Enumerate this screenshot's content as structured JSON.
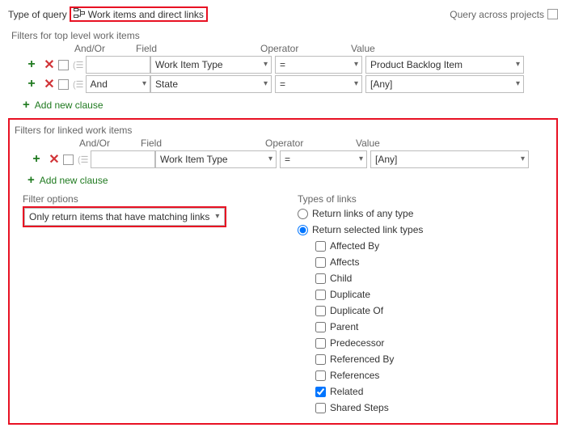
{
  "topbar": {
    "typeOfQueryLabel": "Type of query",
    "queryTypeValue": "Work items and direct links",
    "crossProjectsLabel": "Query across projects"
  },
  "topFilters": {
    "title": "Filters for top level work items",
    "headers": {
      "andOr": "And/Or",
      "field": "Field",
      "operator": "Operator",
      "value": "Value"
    },
    "rows": [
      {
        "andOr": "",
        "field": "Work Item Type",
        "operator": "=",
        "value": "Product Backlog Item"
      },
      {
        "andOr": "And",
        "field": "State",
        "operator": "=",
        "value": "[Any]"
      }
    ],
    "addClause": "Add new clause"
  },
  "linkedFilters": {
    "title": "Filters for linked work items",
    "headers": {
      "andOr": "And/Or",
      "field": "Field",
      "operator": "Operator",
      "value": "Value"
    },
    "rows": [
      {
        "andOr": "",
        "field": "Work Item Type",
        "operator": "=",
        "value": "[Any]"
      }
    ],
    "addClause": "Add new clause",
    "filterOptionsLabel": "Filter options",
    "filterOptionsValue": "Only return items that have matching links",
    "typesOfLinksLabel": "Types of links",
    "radioAny": "Return links of any type",
    "radioSelected": "Return selected link types",
    "radioChoice": "selected",
    "linkTypes": [
      {
        "label": "Affected By",
        "checked": false
      },
      {
        "label": "Affects",
        "checked": false
      },
      {
        "label": "Child",
        "checked": false
      },
      {
        "label": "Duplicate",
        "checked": false
      },
      {
        "label": "Duplicate Of",
        "checked": false
      },
      {
        "label": "Parent",
        "checked": false
      },
      {
        "label": "Predecessor",
        "checked": false
      },
      {
        "label": "Referenced By",
        "checked": false
      },
      {
        "label": "References",
        "checked": false
      },
      {
        "label": "Related",
        "checked": true
      },
      {
        "label": "Shared Steps",
        "checked": false
      }
    ]
  }
}
